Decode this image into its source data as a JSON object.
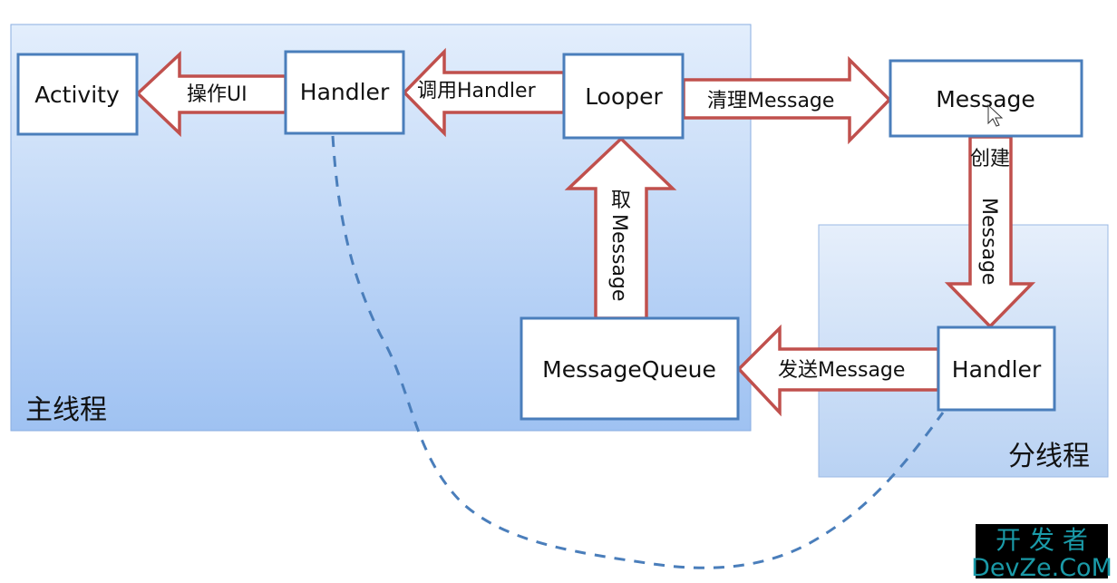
{
  "main_thread": {
    "label": "主线程"
  },
  "sub_thread": {
    "label": "分线程"
  },
  "nodes": {
    "activity": "Activity",
    "handler_main": "Handler",
    "looper": "Looper",
    "message": "Message",
    "message_queue": "MessageQueue",
    "handler_sub": "Handler"
  },
  "edges": {
    "operate_ui": "操作UI",
    "call_handler": "调用Handler",
    "clean_message": "清理Message",
    "take_message_1": "取",
    "take_message_2": "Message",
    "create_message_1": "创建",
    "create_message_2": "Message",
    "send_message": "发送Message"
  },
  "watermark": {
    "line1": "开 发 者",
    "line2": "DevZe.CoM"
  },
  "colors": {
    "box_border": "#4a7ebb",
    "arrow_border": "#c0504d",
    "dashed_link": "#4a7ebb",
    "watermark": "#1a9aa8"
  }
}
